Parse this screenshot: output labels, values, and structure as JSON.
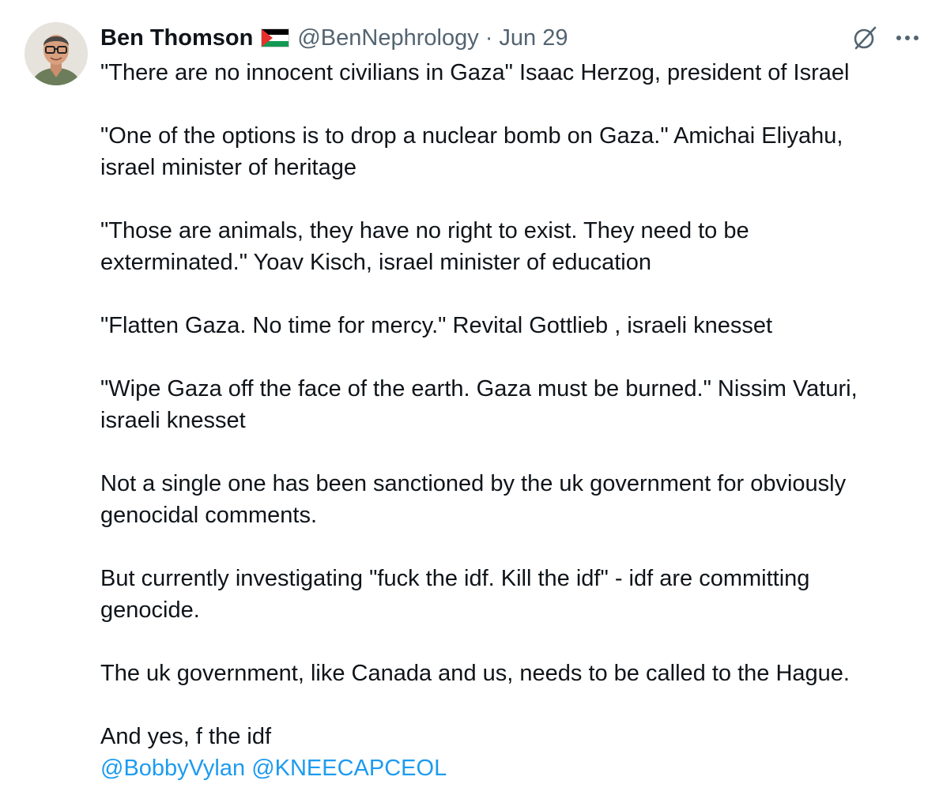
{
  "author": {
    "display_name": "Ben Thomson",
    "flag_icon": "palestine-flag-icon",
    "handle": "@BenNephrology",
    "separator": "·",
    "date": "Jun 29"
  },
  "actions": {
    "grok_icon": "grok-icon",
    "more_icon": "more-options-icon"
  },
  "tweet": {
    "paragraphs": [
      {
        "lines": [
          "\"There are no innocent civilians in Gaza\" Isaac Herzog, president of Israel"
        ]
      },
      {
        "lines": [
          "\"One of the options is to drop a nuclear bomb on Gaza.\" Amichai Eliyahu,",
          "israel minister of heritage"
        ]
      },
      {
        "lines": [
          "\"Those are animals, they have no right to exist. They need to be",
          "exterminated.\" Yoav Kisch, israel minister of education"
        ]
      },
      {
        "lines": [
          "\"Flatten Gaza. No time for mercy.\" Revital Gottlieb , israeli knesset"
        ]
      },
      {
        "lines": [
          "\"Wipe Gaza off the face of the earth. Gaza must be burned.\" Nissim Vaturi,",
          "israeli knesset"
        ]
      },
      {
        "lines": [
          "Not a single one has been sanctioned by the uk government for obviously",
          "genocidal comments."
        ]
      },
      {
        "lines": [
          "But currently investigating \"fuck the idf. Kill the idf\" - idf are committing",
          "genocide."
        ]
      },
      {
        "lines": [
          "The uk government, like Canada and us, needs to be called to the Hague."
        ]
      },
      {
        "lines": [
          "And yes, f the idf"
        ]
      }
    ],
    "mentions": [
      "@BobbyVylan",
      "@KNEECAPCEOL"
    ]
  },
  "colors": {
    "text": "#0f1419",
    "secondary": "#536471",
    "link": "#1d9bf0"
  }
}
